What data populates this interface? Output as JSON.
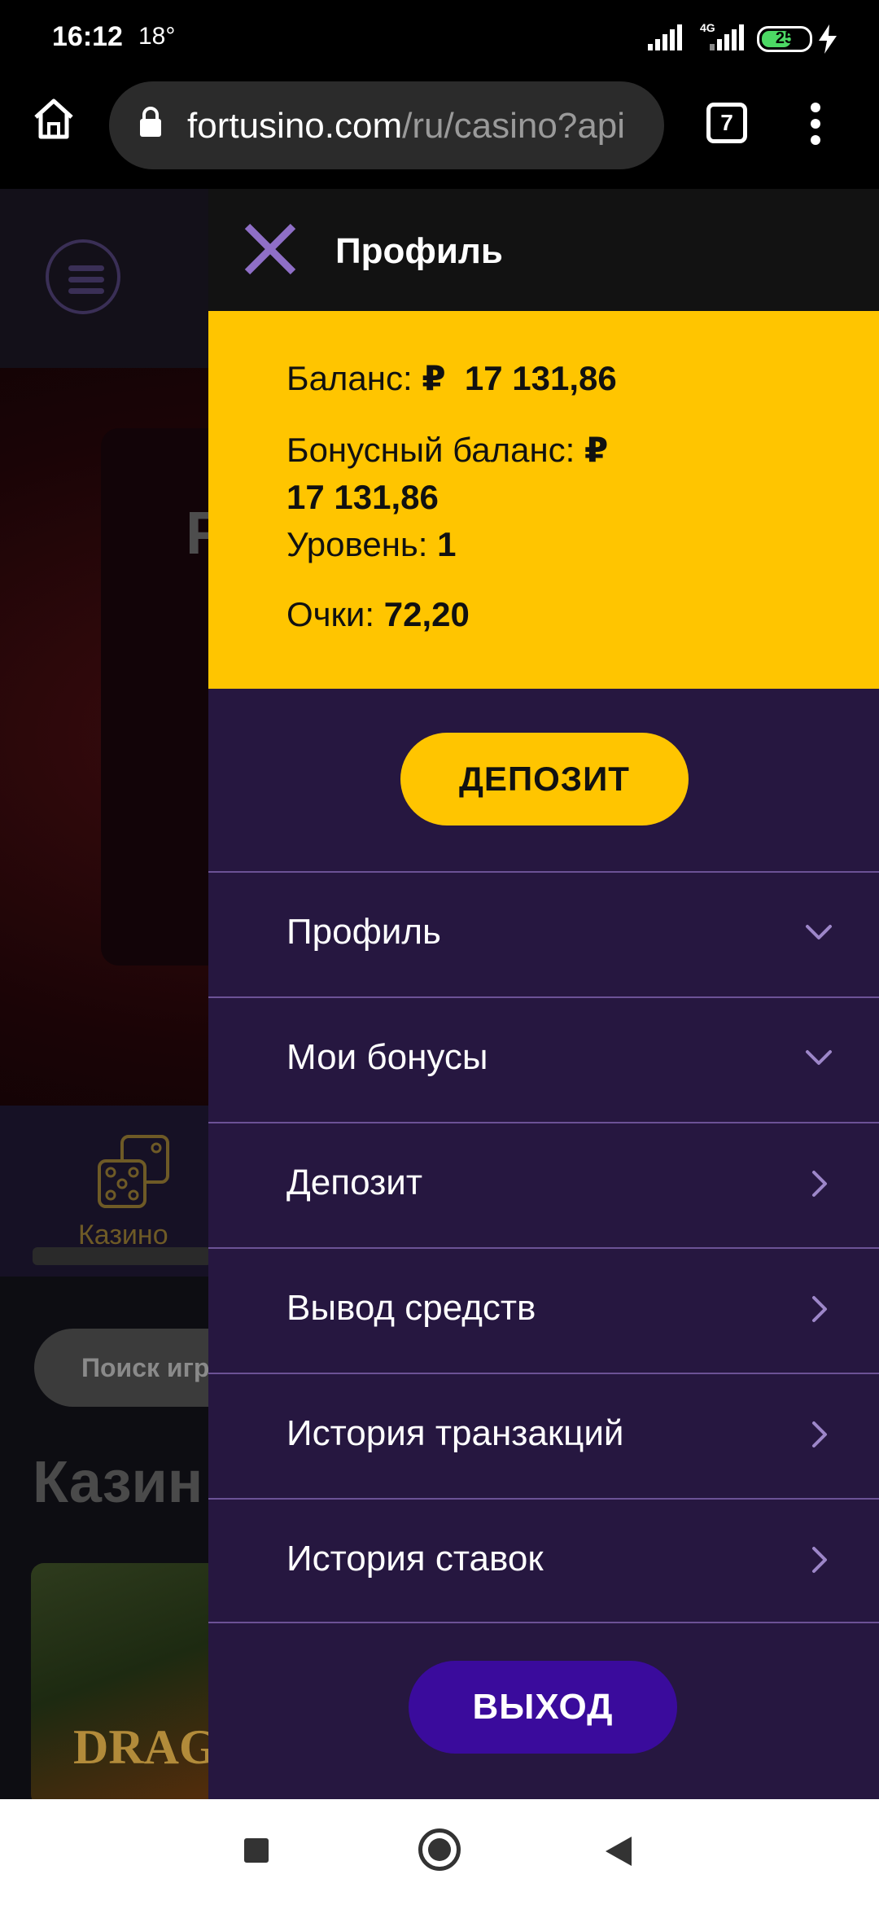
{
  "status_bar": {
    "time": "16:12",
    "temperature": "18°",
    "network_type": "4G",
    "battery_level": "25",
    "battery_fraction": 0.25,
    "battery_color": "#4cd964"
  },
  "browser": {
    "url_host": "fortusino.com",
    "url_path": "/ru/casino?api",
    "tab_count": "7",
    "icons": [
      "home-icon",
      "lock-icon",
      "tabs-icon",
      "more-vert-icon"
    ]
  },
  "background_page": {
    "banner_letter": "P",
    "casino_tab_label": "Казино",
    "search_placeholder": "Поиск игр",
    "section_heading": "Казин",
    "game_card_text": "DRAG"
  },
  "drawer": {
    "title": "Профиль",
    "balance": {
      "balance_label": "Баланс:",
      "currency_symbol": "₽",
      "balance_value": "17 131,86",
      "bonus_label": "Бонусный баланс:",
      "bonus_value": "17 131,86",
      "level_label": "Уровень:",
      "level_value": "1",
      "points_label": "Очки:",
      "points_value": "72,20"
    },
    "deposit_button": "ДЕПОЗИТ",
    "menu": [
      {
        "label": "Профиль",
        "chevron": "chevron-down-icon"
      },
      {
        "label": "Мои бонусы",
        "chevron": "chevron-down-icon"
      },
      {
        "label": "Депозит",
        "chevron": "chevron-right-icon"
      },
      {
        "label": "Вывод средств",
        "chevron": "chevron-right-icon"
      },
      {
        "label": "История транзакций",
        "chevron": "chevron-right-icon"
      },
      {
        "label": "История ставок",
        "chevron": "chevron-right-icon"
      }
    ],
    "logout_button": "ВЫХОД"
  },
  "colors": {
    "accent_yellow": "#ffc500",
    "drawer_purple": "#261740",
    "logout_purple": "#3a0b9c",
    "chevron_purple": "#9d86c9",
    "close_icon_purple": "#8f6fc7"
  }
}
